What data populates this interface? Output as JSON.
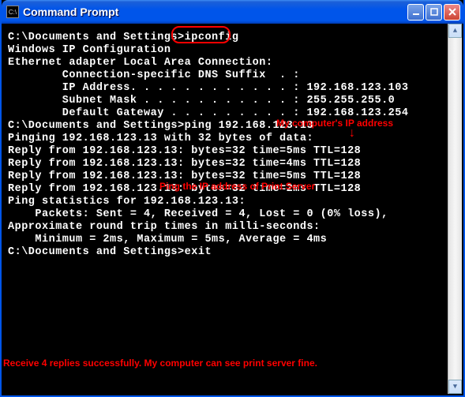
{
  "titlebar": {
    "icon_text": "C:\\",
    "title": "Command Prompt"
  },
  "terminal": {
    "prompt": "C:\\Documents and Settings>",
    "cmd1": "ipconfig",
    "blank": "",
    "l1": "Windows IP Configuration",
    "l2": "Ethernet adapter Local Area Connection:",
    "l3": "        Connection-specific DNS Suffix  . :",
    "l4": "        IP Address. . . . . . . . . . . . : 192.168.123.103",
    "l5": "        Subnet Mask . . . . . . . . . . . : 255.255.255.0",
    "l6": "        Default Gateway . . . . . . . . . : 192.168.123.254",
    "cmd2": "ping 192.168.123.13",
    "l7": "Pinging 192.168.123.13 with 32 bytes of data:",
    "l8": "Reply from 192.168.123.13: bytes=32 time=5ms TTL=128",
    "l9": "Reply from 192.168.123.13: bytes=32 time=4ms TTL=128",
    "l10": "Reply from 192.168.123.13: bytes=32 time=5ms TTL=128",
    "l11": "Reply from 192.168.123.13: bytes=32 time=2ms TTL=128",
    "l12": "Ping statistics for 192.168.123.13:",
    "l13": "    Packets: Sent = 4, Received = 4, Lost = 0 (0% loss),",
    "l14": "Approximate round trip times in milli-seconds:",
    "l15": "    Minimum = 2ms, Maximum = 5ms, Average = 4ms",
    "cmd3": "exit"
  },
  "annotations": {
    "a1": "My computer's IP address",
    "a2": "Ping the IP address of Print Server",
    "a3": "Receive 4 replies successfully.  My computer can see print server fine.",
    "arrow": "↓"
  }
}
